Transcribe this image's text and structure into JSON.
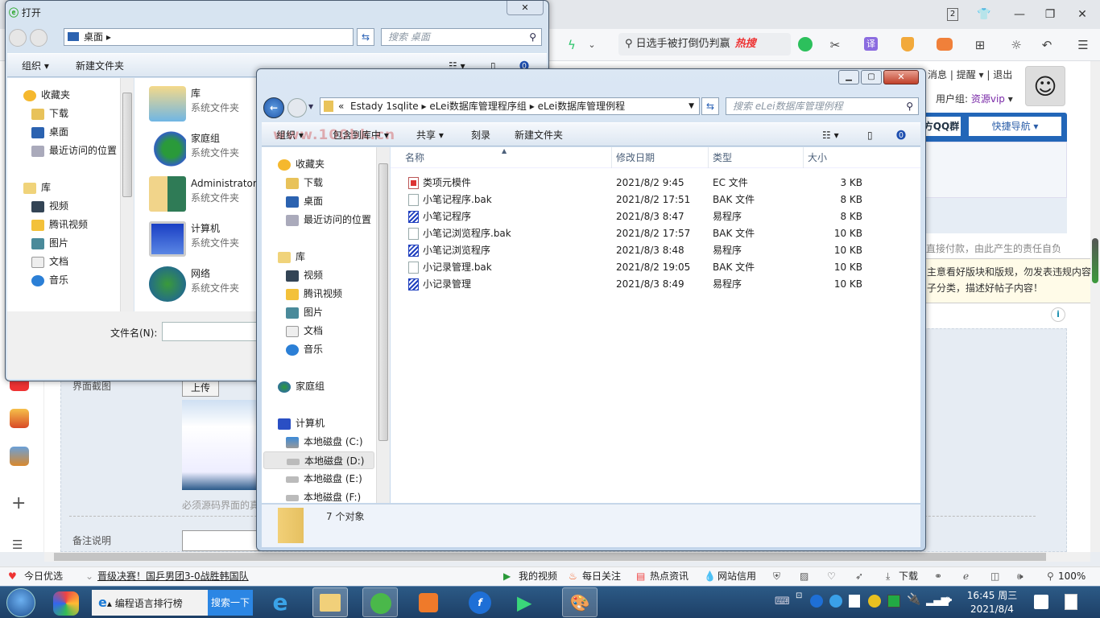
{
  "browser": {
    "tab_count": "2",
    "search_placeholder": "日选手被打倒仍判赢",
    "hot_label": "热搜",
    "window_controls": {
      "skin": "skin-icon",
      "min": "—",
      "max": "❐",
      "close": "✕"
    },
    "toolbar_icons": [
      "grid-icon",
      "lightning-icon",
      "chevron-down-icon",
      "wechat-icon",
      "scissors-icon",
      "translate-icon",
      "shield-coin-icon",
      "game-icon",
      "apps-icon",
      "brightness-icon",
      "undo-icon",
      "menu-icon"
    ],
    "translate_label": "译"
  },
  "webpage": {
    "user_links": [
      "消息",
      "提醒",
      "退出"
    ],
    "user_group_label": "用户组:",
    "user_group_value": "资源vip",
    "qq_group": "方QQ群",
    "quick_nav": "快捷导航",
    "notice1": "直接付款，由此产生的责任自负",
    "notice2a": "主意看好版块和版规，勿发表违规内容",
    "notice2b": "子分类，描述好帖子内容！",
    "screenshot_label": "界面截图",
    "upload_button": "上传",
    "screenshot_hint": "必须源码界面的真",
    "remark_label": "备注说明",
    "watermark": "www.100bk.cn"
  },
  "open_dialog": {
    "title": "打开",
    "address": "桌面",
    "search_placeholder": "搜索 桌面",
    "toolbar": {
      "organize": "组织",
      "new_folder": "新建文件夹"
    },
    "nav": {
      "favorites": "收藏夹",
      "favorites_items": [
        "下载",
        "桌面",
        "最近访问的位置"
      ],
      "libraries": "库",
      "library_items": [
        "视频",
        "腾讯视频",
        "图片",
        "文档",
        "音乐"
      ]
    },
    "items": [
      {
        "name": "库",
        "sub": "系统文件夹"
      },
      {
        "name": "家庭组",
        "sub": "系统文件夹"
      },
      {
        "name": "Administrator",
        "sub": "系统文件夹"
      },
      {
        "name": "计算机",
        "sub": "系统文件夹"
      },
      {
        "name": "网络",
        "sub": "系统文件夹"
      }
    ],
    "filename_label": "文件名(N):",
    "filename_value": ""
  },
  "explorer": {
    "breadcrumb": [
      "«",
      "Estady 1sqlite",
      "eLei数据库管理程序组",
      "eLei数据库管理例程"
    ],
    "search_placeholder": "搜索 eLei数据库管理例程",
    "toolbar": {
      "organize": "组织",
      "include_library": "包含到库中",
      "share": "共享",
      "burn": "刻录",
      "new_folder": "新建文件夹"
    },
    "nav": {
      "favorites": "收藏夹",
      "favorites_items": [
        "下载",
        "桌面",
        "最近访问的位置"
      ],
      "libraries": "库",
      "library_items": [
        "视频",
        "腾讯视频",
        "图片",
        "文档",
        "音乐"
      ],
      "homegroup": "家庭组",
      "computer": "计算机",
      "drives": [
        "本地磁盘 (C:)",
        "本地磁盘 (D:)",
        "本地磁盘 (E:)",
        "本地磁盘 (F:)"
      ],
      "selected_drive": 1
    },
    "columns": [
      "名称",
      "修改日期",
      "类型",
      "大小"
    ],
    "files": [
      {
        "name": "类项元模件",
        "date": "2021/8/2 9:45",
        "type": "EC 文件",
        "size": "3 KB",
        "icon": "ec"
      },
      {
        "name": "小笔记程序.bak",
        "date": "2021/8/2 17:51",
        "type": "BAK 文件",
        "size": "8 KB",
        "icon": "bak"
      },
      {
        "name": "小笔记程序",
        "date": "2021/8/3 8:47",
        "type": "易程序",
        "size": "8 KB",
        "icon": "ex"
      },
      {
        "name": "小笔记浏览程序.bak",
        "date": "2021/8/2 17:57",
        "type": "BAK 文件",
        "size": "10 KB",
        "icon": "bak"
      },
      {
        "name": "小笔记浏览程序",
        "date": "2021/8/3 8:48",
        "type": "易程序",
        "size": "10 KB",
        "icon": "ex"
      },
      {
        "name": "小记录管理.bak",
        "date": "2021/8/2 19:05",
        "type": "BAK 文件",
        "size": "10 KB",
        "icon": "bak"
      },
      {
        "name": "小记录管理",
        "date": "2021/8/3 8:49",
        "type": "易程序",
        "size": "10 KB",
        "icon": "ex"
      }
    ],
    "status": "7 个对象"
  },
  "statusbar": {
    "today_pick": "今日优选",
    "headline": "晋级决赛！国乒男团3-0战胜韩国队",
    "my_video": "我的视频",
    "daily_follow": "每日关注",
    "hot_news": "热点资讯",
    "site_credit": "网站信用",
    "download": "下载",
    "zoom": "100%"
  },
  "taskbar": {
    "search_text": "编程语言排行榜",
    "search_button": "搜索一下",
    "time": "16:45 周三",
    "date": "2021/8/4"
  }
}
